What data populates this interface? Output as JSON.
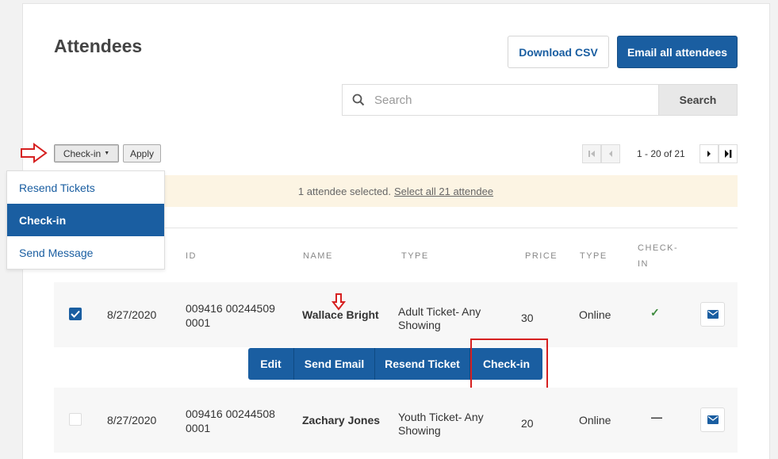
{
  "page": {
    "title": "Attendees"
  },
  "header": {
    "download_csv": "Download CSV",
    "email_all": "Email all attendees"
  },
  "search": {
    "placeholder": "Search",
    "button": "Search"
  },
  "bulk": {
    "selected_action": "Check-in",
    "apply": "Apply",
    "options": [
      "Resend Tickets",
      "Check-in",
      "Send Message"
    ]
  },
  "pagination": {
    "range": "1 - 20 of 21"
  },
  "banner": {
    "text": "1 attendee selected.",
    "link": "Select all 21 attendee"
  },
  "table": {
    "headers": [
      "ID",
      "NAME",
      "TYPE",
      "PRICE",
      "TYPE",
      "CHECK-",
      "IN"
    ],
    "rows": [
      {
        "checked": true,
        "date": "8/27/2020",
        "id_line1": "009416 00244509",
        "id_line2": "0001",
        "name": "Wallace Bright",
        "type_line1": "Adult Ticket- Any",
        "type_line2": "Showing",
        "price": "30",
        "channel": "Online",
        "checkin": "✓"
      },
      {
        "checked": false,
        "date": "8/27/2020",
        "id_line1": "009416 00244508",
        "id_line2": "0001",
        "name": "Zachary Jones",
        "type_line1": "Youth Ticket- Any",
        "type_line2": "Showing",
        "price": "20",
        "channel": "Online",
        "checkin": "—"
      }
    ]
  },
  "row_actions": [
    "Edit",
    "Send Email",
    "Resend Ticket",
    "Check-in"
  ],
  "colors": {
    "primary": "#1a5ea1",
    "banner_bg": "#fcf4e3",
    "annotation_red": "#d62020",
    "check_green": "#3c8a3c"
  },
  "icons": [
    "search-icon",
    "caret-down-icon",
    "first-page-icon",
    "prev-page-icon",
    "next-page-icon",
    "last-page-icon",
    "check-icon",
    "mail-icon",
    "red-arrow-right-icon",
    "red-arrow-down-icon"
  ]
}
